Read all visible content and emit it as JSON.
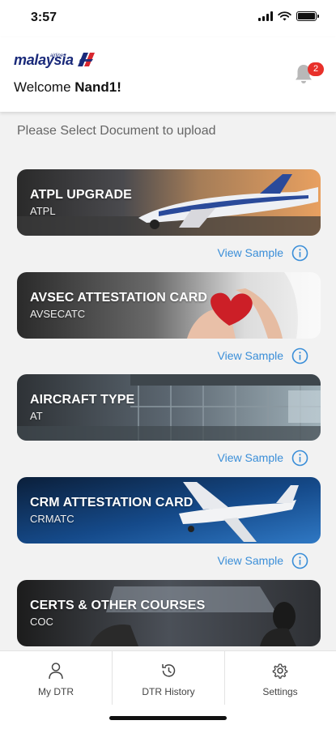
{
  "status": {
    "time": "3:57"
  },
  "header": {
    "logo_text": "malaysia",
    "logo_sub": "airlines",
    "welcome_prefix": "Welcome ",
    "user_name": "Nand1!",
    "notification_count": "2"
  },
  "prompt": "Please Select Document to upload",
  "documents": [
    {
      "title": "ATPL UPGRADE",
      "code": "ATPL",
      "sample_label": "View Sample"
    },
    {
      "title": "AVSEC ATTESTATION CARD",
      "code": "AVSECATC",
      "sample_label": "View Sample"
    },
    {
      "title": "AIRCRAFT TYPE",
      "code": "AT",
      "sample_label": "View Sample"
    },
    {
      "title": "CRM ATTESTATION CARD",
      "code": "CRMATC",
      "sample_label": "View Sample"
    },
    {
      "title": "CERTS & OTHER COURSES",
      "code": "COC"
    }
  ],
  "tabs": [
    {
      "label": "My DTR",
      "icon": "person-icon"
    },
    {
      "label": "DTR History",
      "icon": "history-icon"
    },
    {
      "label": "Settings",
      "icon": "gear-icon"
    }
  ],
  "colors": {
    "accent": "#3a8ed8",
    "brand": "#1a2a7a",
    "badge": "#e8302a"
  }
}
